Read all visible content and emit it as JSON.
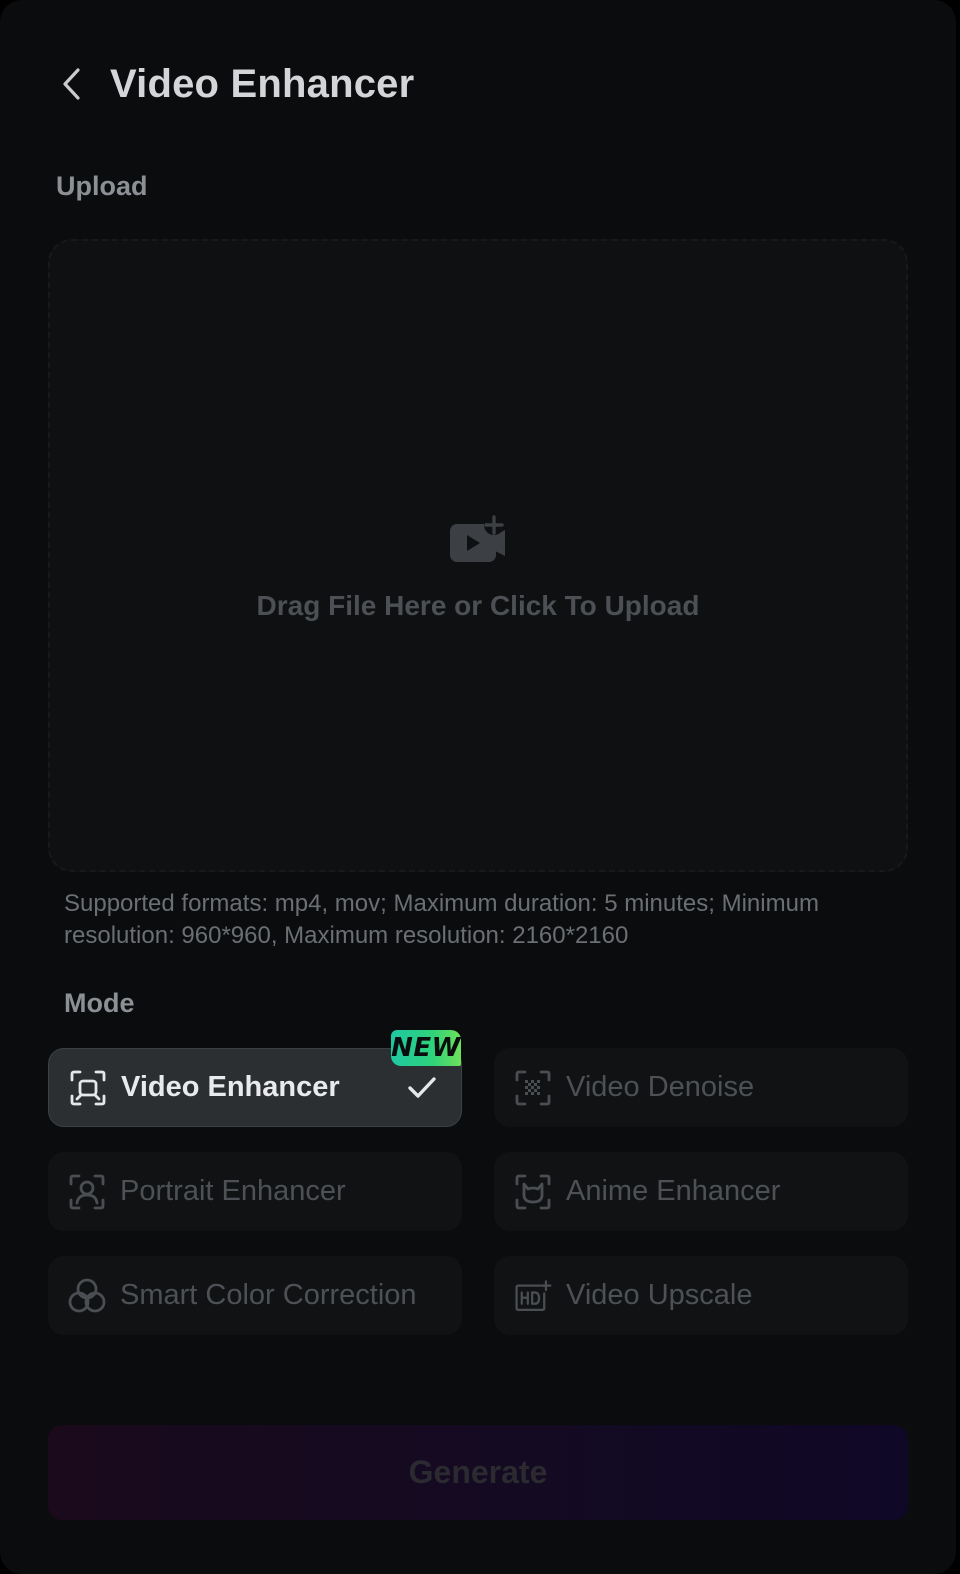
{
  "header": {
    "title": "Video Enhancer",
    "back_icon": "chevron-left-icon"
  },
  "upload": {
    "section_label": "Upload",
    "prompt": "Drag File Here or Click To Upload",
    "icon": "video-add-icon",
    "hint": "Supported formats: mp4, mov; Maximum duration: 5 minutes; Minimum resolution: 960*960, Maximum resolution: 2160*2160"
  },
  "mode": {
    "section_label": "Mode",
    "selected": "Video Enhancer",
    "badge": "NEW",
    "options": [
      {
        "label": "Video Enhancer",
        "icon": "focus-frame-icon"
      },
      {
        "label": "Video Denoise",
        "icon": "denoise-icon"
      },
      {
        "label": "Portrait Enhancer",
        "icon": "portrait-frame-icon"
      },
      {
        "label": "Anime Enhancer",
        "icon": "anime-frame-icon"
      },
      {
        "label": "Smart Color Correction",
        "icon": "color-circles-icon"
      },
      {
        "label": "Video Upscale",
        "icon": "hd-upscale-icon"
      }
    ]
  },
  "actions": {
    "generate_label": "Generate"
  },
  "colors": {
    "panel_bg": "#0b0c0d",
    "active_mode_bg": "#2b2f32",
    "badge_green": "#2fd27a",
    "generate_gradient_start": "#1a0a1c",
    "generate_gradient_end": "#0f0826"
  }
}
